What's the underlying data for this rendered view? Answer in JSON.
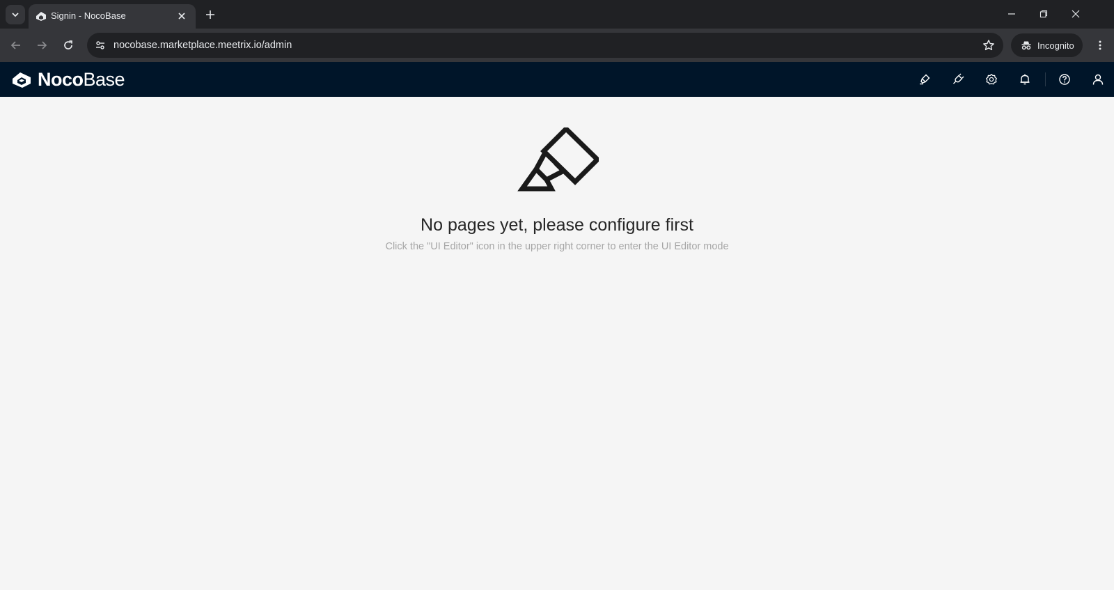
{
  "browser": {
    "tab": {
      "title": "Signin - NocoBase"
    },
    "address_bar": {
      "url": "nocobase.marketplace.meetrix.io/admin"
    },
    "incognito_label": "Incognito"
  },
  "app": {
    "logo": {
      "part1": "Noco",
      "part2": "Base"
    },
    "header_icons": [
      "highlight-icon",
      "plugin-icon",
      "settings-icon",
      "bell-icon",
      "help-icon",
      "user-icon"
    ]
  },
  "empty_state": {
    "icon": "highlight-marker-icon",
    "title": "No pages yet, please configure first",
    "description": "Click the \"UI Editor\" icon in the upper right corner to enter the UI Editor mode"
  },
  "colors": {
    "header_bg": "#001529",
    "page_bg": "#f5f5f5",
    "browser_dark": "#202124",
    "browser_toolbar": "#35363a"
  }
}
